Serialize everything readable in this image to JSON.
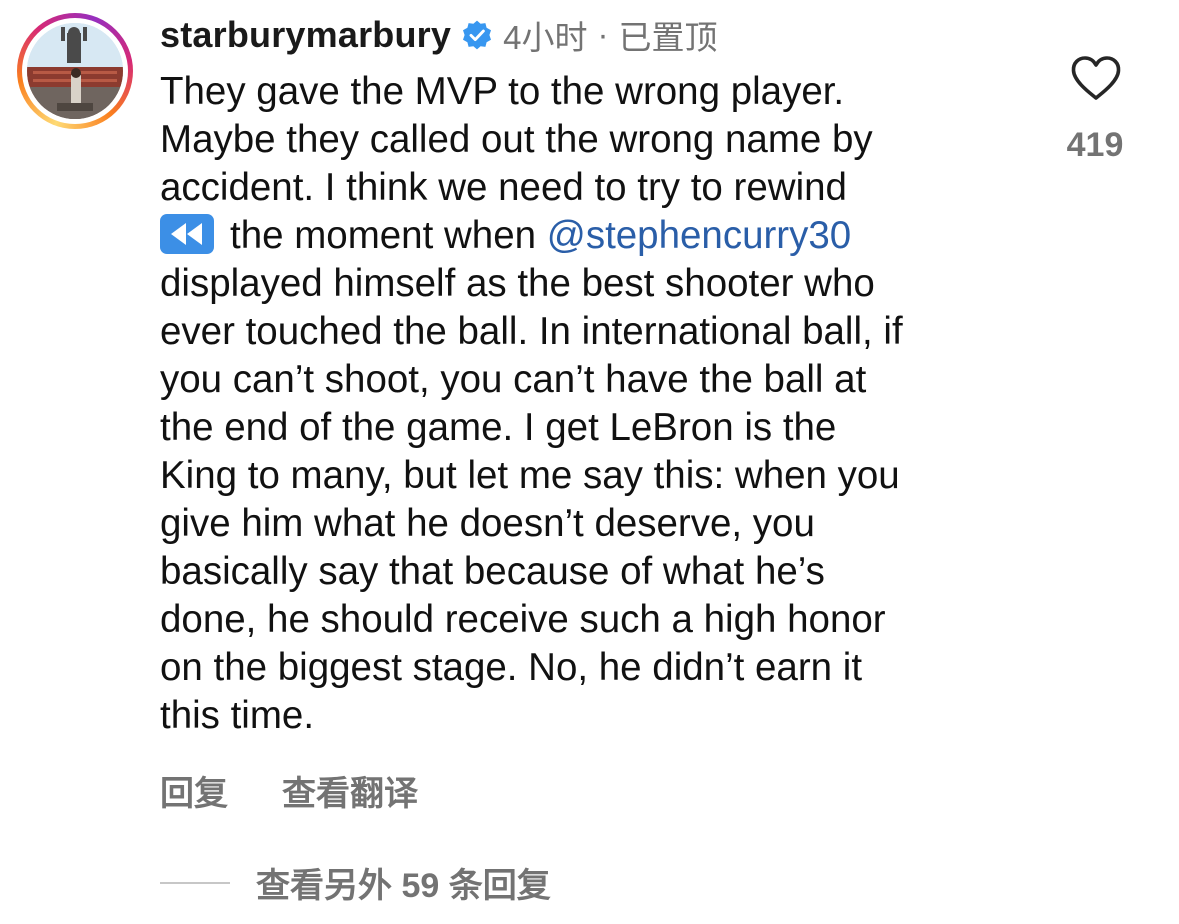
{
  "comment": {
    "username": "starburymarbury",
    "time": "4小时",
    "pinned": "已置顶",
    "lines": [
      {
        "text": "They gave the MVP to the wrong player."
      },
      {
        "text": "Maybe they called out the wrong name by"
      },
      {
        "text": "accident. I think we need to try to rewind"
      },
      {
        "pre": "the moment when ",
        "mention": "@stephencurry30"
      },
      {
        "text": "displayed himself as the best shooter who"
      },
      {
        "text": "ever touched the ball. In international ball, if"
      },
      {
        "text": "you can’t shoot, you can’t have the ball at"
      },
      {
        "text": "the end of the game. I get LeBron is the"
      },
      {
        "text": "King to many, but let me say this: when you"
      },
      {
        "text": "give him what he doesn’t deserve, you"
      },
      {
        "text": "basically say that because of what he’s"
      },
      {
        "text": "done, he should receive such a high honor"
      },
      {
        "text": "on the biggest stage. No, he didn’t earn it"
      },
      {
        "text": "this time."
      }
    ],
    "likes": "419",
    "reply_label": "回复",
    "translate_label": "查看翻译",
    "more_replies_label": "查看另外 59 条回复",
    "icons": {
      "verified": "verified-badge-icon",
      "like": "heart-icon",
      "rewind": "rewind-emoji-icon"
    },
    "colors": {
      "mention": "#2a5ea8",
      "verified": "#3897f0",
      "muted": "#737373"
    }
  }
}
